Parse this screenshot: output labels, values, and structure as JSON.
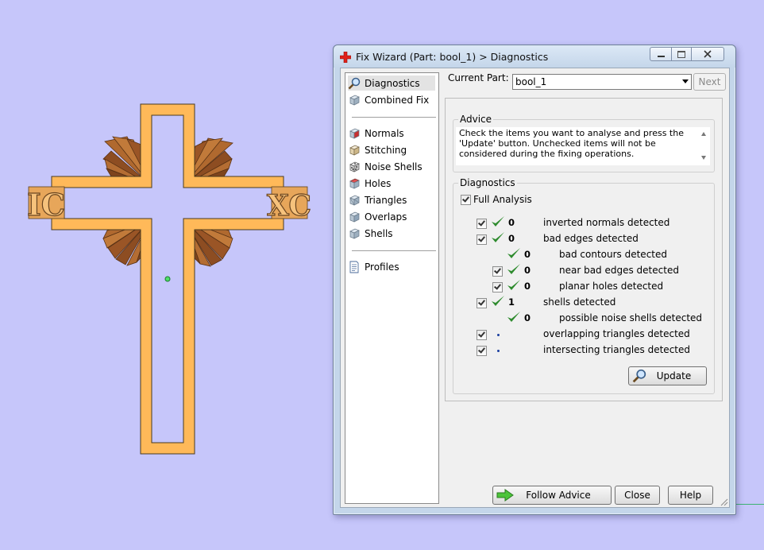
{
  "window": {
    "title": "Fix Wizard (Part: bool_1) > Diagnostics"
  },
  "nav": {
    "items": [
      {
        "label": "Diagnostics",
        "icon": "magnifier-icon",
        "selected": true
      },
      {
        "label": "Combined Fix",
        "icon": "cube-icon"
      },
      {
        "label": "Normals",
        "icon": "normals-cube-icon"
      },
      {
        "label": "Stitching",
        "icon": "stitching-cube-icon"
      },
      {
        "label": "Noise Shells",
        "icon": "noise-dice-icon"
      },
      {
        "label": "Holes",
        "icon": "holes-cube-icon"
      },
      {
        "label": "Triangles",
        "icon": "triangles-cube-icon"
      },
      {
        "label": "Overlaps",
        "icon": "overlaps-cube-icon"
      },
      {
        "label": "Shells",
        "icon": "shells-cube-icon"
      },
      {
        "label": "Profiles",
        "icon": "document-icon"
      }
    ]
  },
  "part": {
    "label": "Current Part:",
    "value": "bool_1",
    "next_label": "Next"
  },
  "advice": {
    "title": "Advice",
    "text": "Check the items you want to analyse and press the 'Update' button. Unchecked items will not be considered during the fixing operations."
  },
  "diagnostics": {
    "title": "Diagnostics",
    "full_analysis_label": "Full Analysis",
    "rows": [
      {
        "count": "0",
        "label": "inverted normals detected",
        "checkbox": true,
        "status": "ok"
      },
      {
        "count": "0",
        "label": "bad edges detected",
        "checkbox": true,
        "status": "ok"
      },
      {
        "count": "0",
        "label": "bad contours detected",
        "checkbox": false,
        "status": "ok"
      },
      {
        "count": "0",
        "label": "near bad edges detected",
        "checkbox": true,
        "status": "ok"
      },
      {
        "count": "0",
        "label": "planar holes detected",
        "checkbox": true,
        "status": "ok"
      },
      {
        "count": "1",
        "label": "shells detected",
        "checkbox": true,
        "status": "ok"
      },
      {
        "count": "0",
        "label": "possible noise shells detected",
        "checkbox": false,
        "status": "ok"
      },
      {
        "count": "",
        "label": "overlapping triangles detected",
        "checkbox": true,
        "status": "pending"
      },
      {
        "count": "",
        "label": "intersecting triangles detected",
        "checkbox": true,
        "status": "pending"
      }
    ],
    "update_label": "Update"
  },
  "footer": {
    "follow_advice_label": "Follow Advice",
    "close_label": "Close",
    "help_label": "Help"
  },
  "colors": {
    "viewport_background": "#c6c6fa",
    "part_fill": "#ffb959",
    "fin_fill": "#a8622c",
    "check_green": "#2e8b2e"
  },
  "viewport": {
    "left_lettering": "IC",
    "right_lettering": "XC"
  }
}
